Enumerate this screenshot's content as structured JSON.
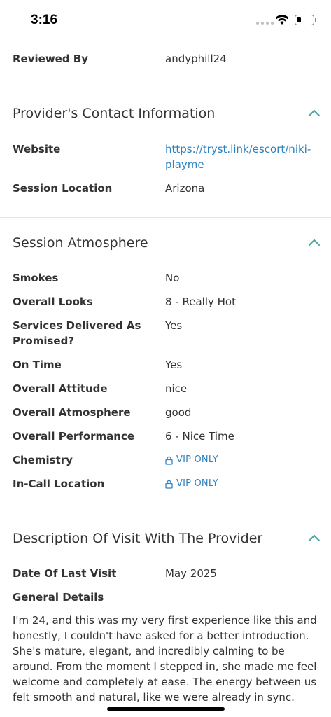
{
  "status_bar": {
    "time": "3:16",
    "icons": [
      "signal-dots-icon",
      "wifi-icon",
      "battery-icon"
    ]
  },
  "review": {
    "reviewed_by_label": "Reviewed By",
    "reviewed_by_value": "andyphill24"
  },
  "contact": {
    "title": "Provider's Contact Information",
    "website_label": "Website",
    "website_value": "https://tryst.link/escort/niki-playme",
    "location_label": "Session Location",
    "location_value": "Arizona"
  },
  "atmosphere": {
    "title": "Session Atmosphere",
    "rows": [
      {
        "label": "Smokes",
        "value": "No"
      },
      {
        "label": "Overall Looks",
        "value": "8 - Really Hot"
      },
      {
        "label": "Services Delivered As Promised?",
        "value": "Yes"
      },
      {
        "label": "On Time",
        "value": "Yes"
      },
      {
        "label": "Overall Attitude",
        "value": "nice"
      },
      {
        "label": "Overall Atmosphere",
        "value": "good"
      },
      {
        "label": "Overall Performance",
        "value": "6 - Nice Time"
      },
      {
        "label": "Chemistry",
        "value": "VIP ONLY"
      },
      {
        "label": "In-Call Location",
        "value": "VIP ONLY"
      }
    ]
  },
  "description": {
    "title": "Description Of Visit With The Provider",
    "date_label": "Date Of Last Visit",
    "date_value": "May 2025",
    "details_label": "General Details",
    "details_text": "I'm 24, and this was my very first experience like this and honestly, I couldn't have asked for a better introduction. She's mature, elegant, and incredibly calming to be around. From the moment I stepped in, she made me feel welcome and completely at ease. The energy between us felt smooth and natural, like we were already in sync."
  },
  "colors": {
    "accent": "#4aa8a8",
    "link": "#2b82c0",
    "text": "#333333",
    "divider": "#e4e4e4"
  }
}
